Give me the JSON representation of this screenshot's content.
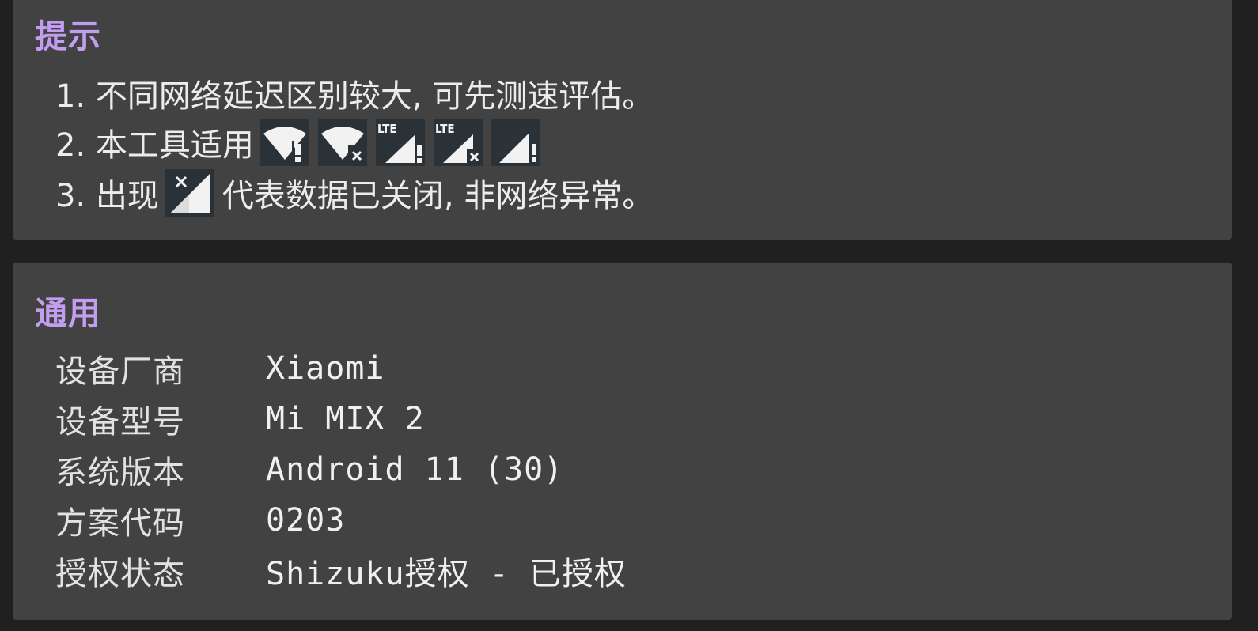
{
  "tips": {
    "title": "提示",
    "line1": "1. 不同网络延迟区别较大, 可先测速评估。",
    "line2_prefix": "2. 本工具适用",
    "line3_prefix": "3. 出现",
    "line3_suffix": "代表数据已关闭, 非网络异常。",
    "icon_lte_label": "LTE",
    "icons": [
      "wifi-warning-icon",
      "wifi-off-icon",
      "lte-signal-warning-icon",
      "lte-signal-off-icon",
      "signal-warning-icon",
      "data-disabled-signal-icon"
    ]
  },
  "general": {
    "title": "通用",
    "rows": [
      {
        "label": "设备厂商",
        "value": "Xiaomi"
      },
      {
        "label": "设备型号",
        "value": "Mi MIX 2"
      },
      {
        "label": "系统版本",
        "value": "Android 11 (30)"
      },
      {
        "label": "方案代码",
        "value": "0203"
      },
      {
        "label": "授权状态",
        "value": "Shizuku授权 - 已授权"
      }
    ]
  },
  "colors": {
    "background": "#202020",
    "card": "#424242",
    "accent": "#c39df0",
    "icon_bg": "#2b3237"
  }
}
